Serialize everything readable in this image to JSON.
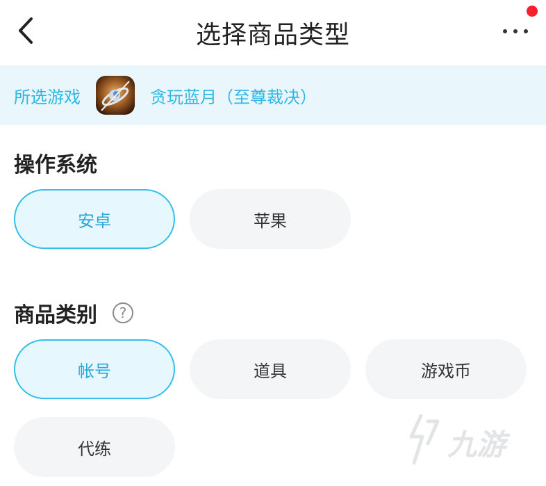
{
  "header": {
    "title": "选择商品类型",
    "back_icon": "chevron-left-icon",
    "more_icon": "more-dots-icon",
    "badge_color": "#f5222d"
  },
  "game_bar": {
    "label": "所选游戏",
    "game_name": "贪玩蓝月（至尊裁决）",
    "accent_color": "#2eb7e6"
  },
  "os_section": {
    "title": "操作系统",
    "options": [
      {
        "label": "安卓",
        "selected": true
      },
      {
        "label": "苹果",
        "selected": false
      }
    ]
  },
  "category_section": {
    "title": "商品类别",
    "help_icon": "question-circle-icon",
    "help_glyph": "?",
    "options": [
      {
        "label": "帐号",
        "selected": true
      },
      {
        "label": "道具",
        "selected": false
      },
      {
        "label": "游戏币",
        "selected": false
      },
      {
        "label": "代练",
        "selected": false
      }
    ]
  },
  "watermark": {
    "text": "九游",
    "icon": "jiuyou-watermark-logo"
  }
}
